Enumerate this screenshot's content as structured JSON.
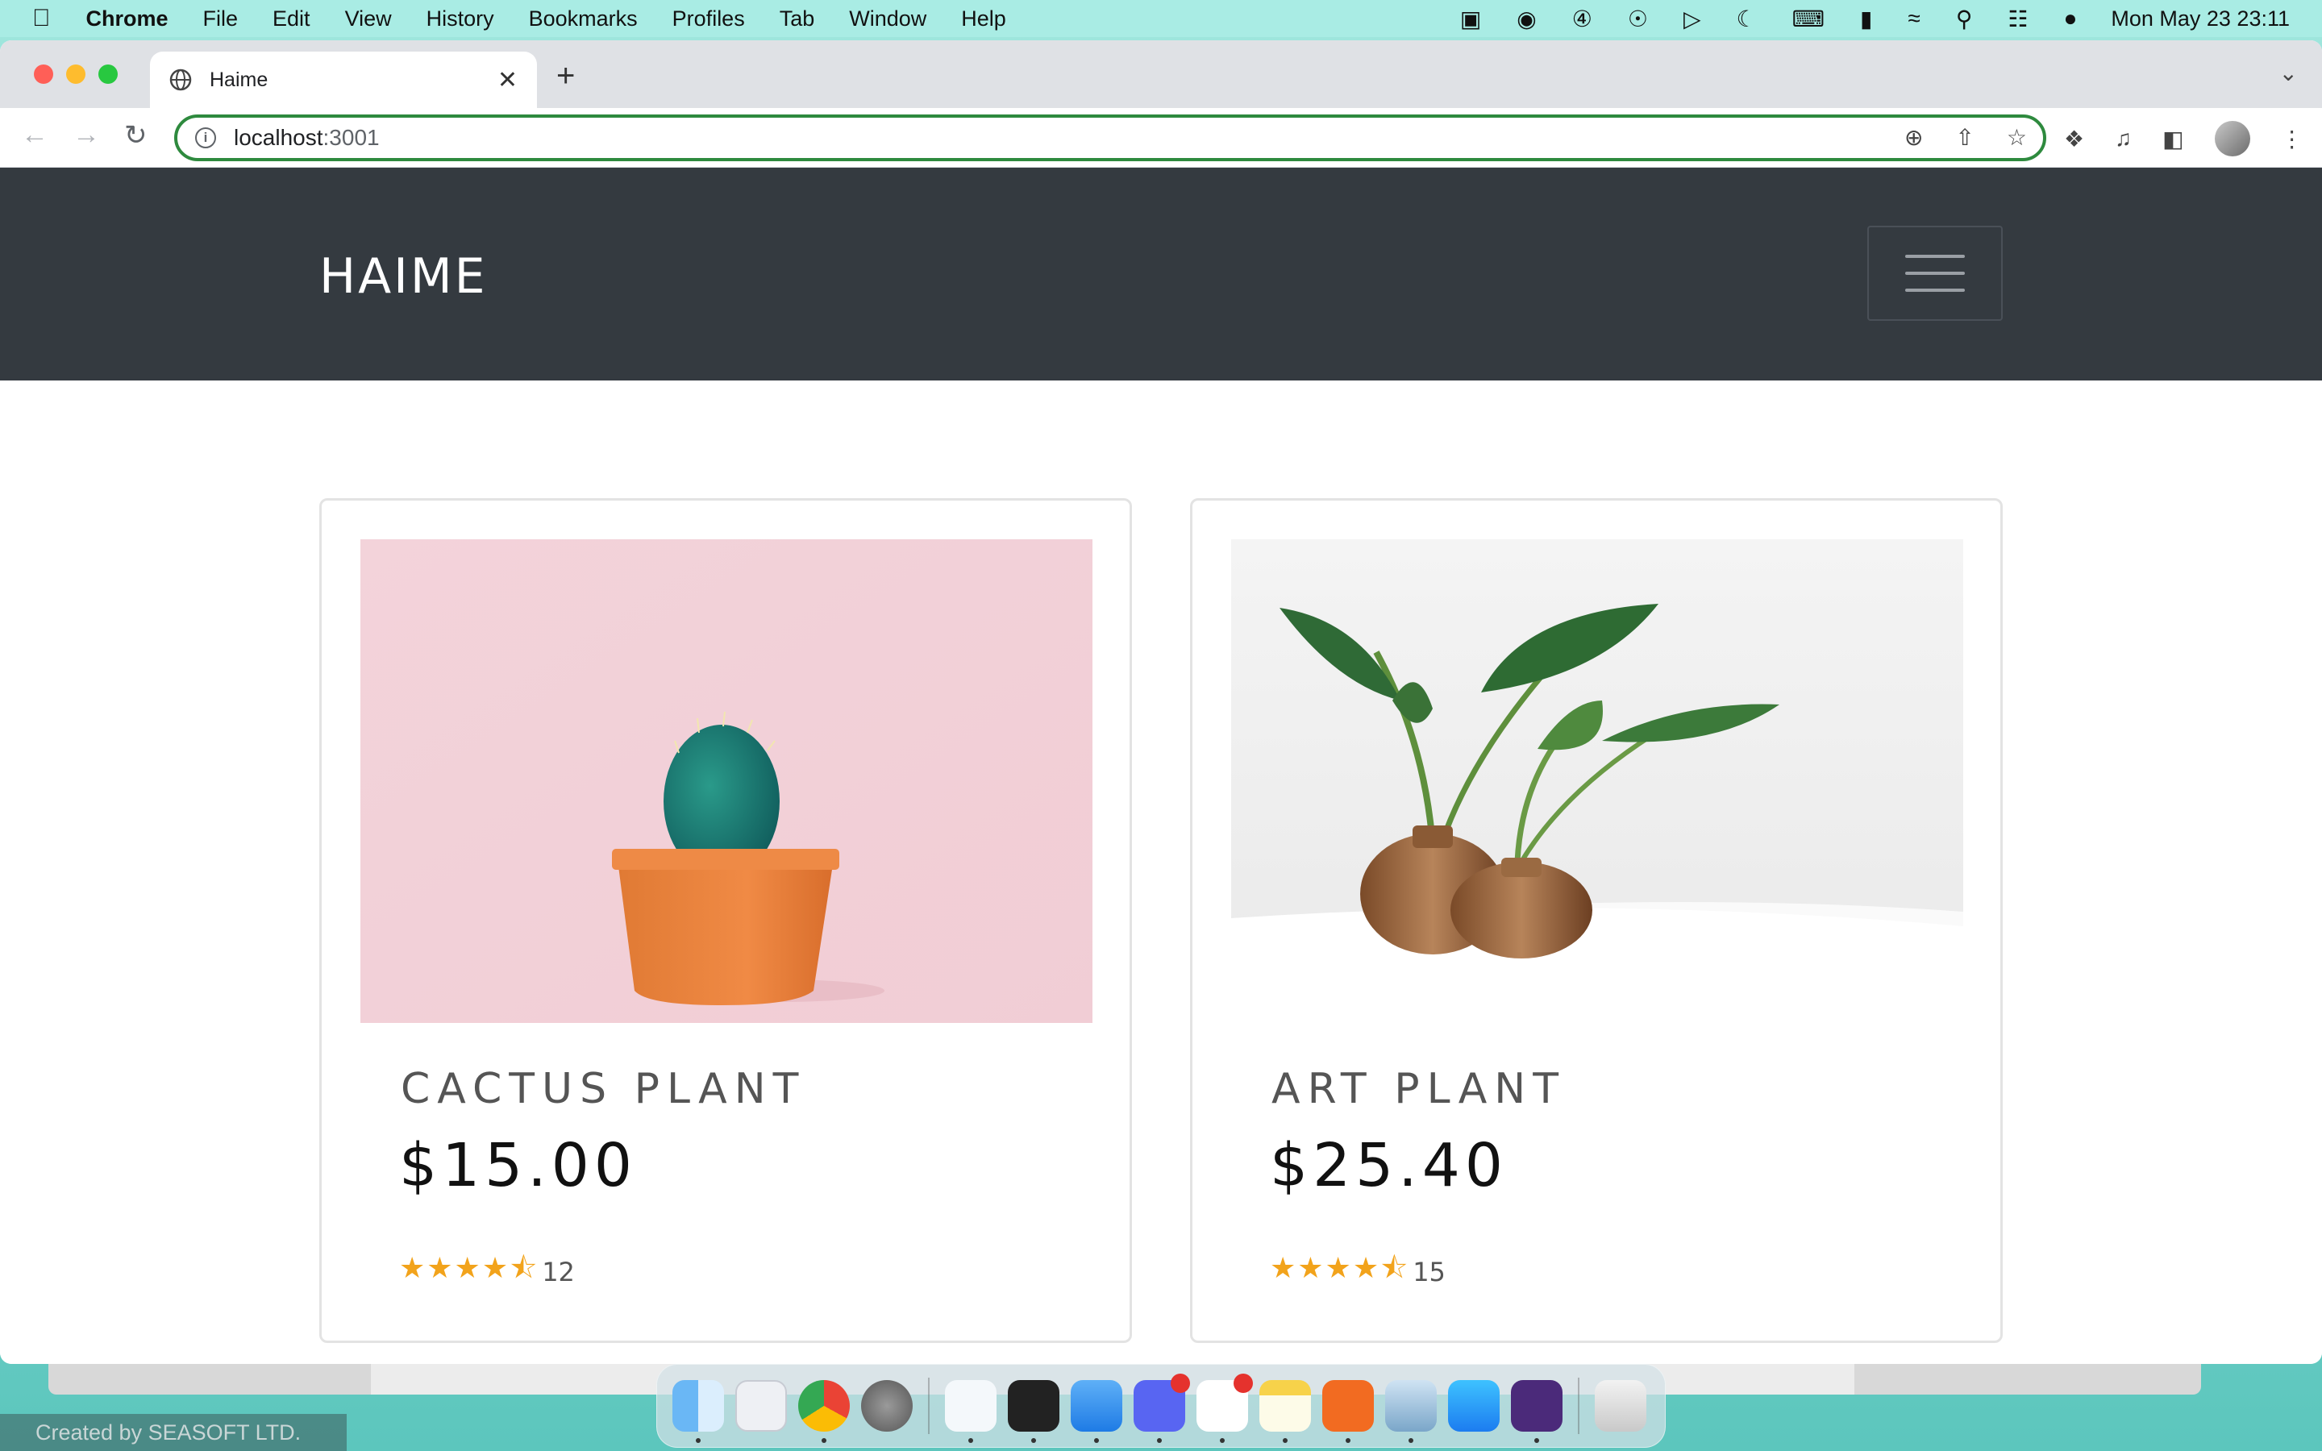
{
  "menubar": {
    "app_name": "Chrome",
    "menus": [
      "File",
      "Edit",
      "View",
      "History",
      "Bookmarks",
      "Profiles",
      "Tab",
      "Window",
      "Help"
    ],
    "clock": "Mon May 23  23:11"
  },
  "browser": {
    "tab_title": "Haime",
    "url_host": "localhost",
    "url_port": ":3001"
  },
  "site": {
    "brand": "HAIME"
  },
  "products": [
    {
      "name": "CACTUS PLANT",
      "price": "$15.00",
      "rating": 4.5,
      "review_count": "12"
    },
    {
      "name": "ART PLANT",
      "price": "$25.40",
      "rating": 4.5,
      "review_count": "15"
    }
  ],
  "background": {
    "created_by": "Created by SEASOFT LTD."
  },
  "dock": {
    "apps": [
      "finder",
      "launchpad",
      "chrome",
      "system-preferences",
      "vscode",
      "terminal",
      "mail",
      "discord",
      "slack",
      "notes",
      "pencil-app",
      "preview",
      "app-store",
      "screen-recorder",
      "trash"
    ]
  },
  "colors": {
    "navbar_bg": "#343a40",
    "star": "#f2a31b",
    "omnibox_focus": "#2e8a3e"
  }
}
